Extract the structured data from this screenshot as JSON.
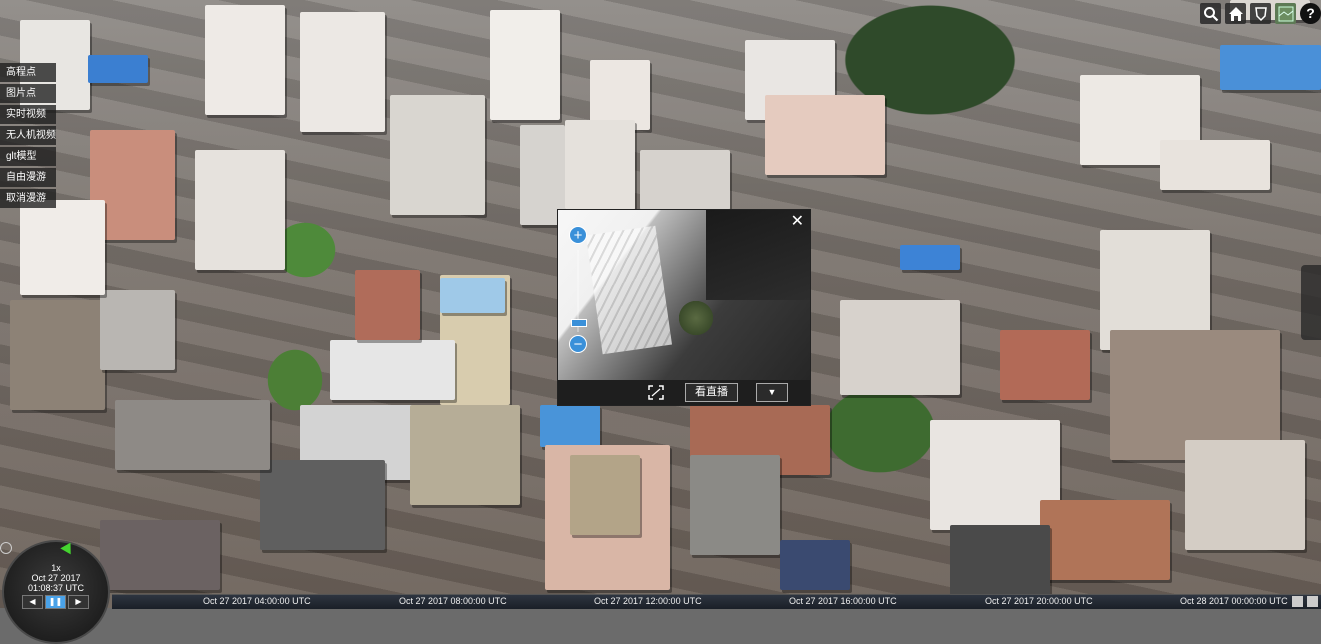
{
  "menu": {
    "items": [
      {
        "label": "高程点"
      },
      {
        "label": "图片点"
      },
      {
        "label": "实时视频"
      },
      {
        "label": "无人机视频"
      },
      {
        "label": "glt模型"
      },
      {
        "label": "自由漫游"
      },
      {
        "label": "取消漫游"
      }
    ]
  },
  "toolbar": {
    "buttons": [
      "search-icon",
      "home-icon",
      "shield-icon",
      "map-layer-icon",
      "help-icon"
    ],
    "help_label": "?"
  },
  "video_popup": {
    "close_label": "✕",
    "zoom_in_label": "+",
    "zoom_out_label": "−",
    "live_label": "看直播",
    "dropdown_label": "▼"
  },
  "clock": {
    "speed": "1x",
    "date": "Oct 27 2017",
    "time": "01:08:37 UTC",
    "controls": [
      "◀",
      "❚❚",
      "▶"
    ]
  },
  "timeline": {
    "labels": [
      "Oct 27 2017 04:00:00 UTC",
      "Oct 27 2017 08:00:00 UTC",
      "Oct 27 2017 12:00:00 UTC",
      "Oct 27 2017 16:00:00 UTC",
      "Oct 27 2017 20:00:00 UTC",
      "Oct 28 2017 00:00:00 UTC"
    ]
  }
}
